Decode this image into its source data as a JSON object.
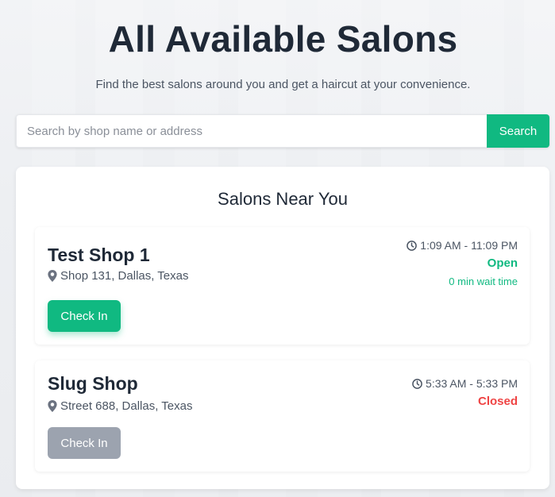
{
  "hero": {
    "title": "All Available Salons",
    "subtitle": "Find the best salons around you and get a haircut at your convenience."
  },
  "search": {
    "placeholder": "Search by shop name or address",
    "value": "",
    "button_label": "Search"
  },
  "panel": {
    "title": "Salons Near You"
  },
  "salons": [
    {
      "name": "Test Shop 1",
      "address": "Shop 131, Dallas, Texas",
      "hours": "1:09 AM - 11:09 PM",
      "status": "Open",
      "wait_time": "0 min wait time",
      "checkin_label": "Check In"
    },
    {
      "name": "Slug Shop",
      "address": "Street 688, Dallas, Texas",
      "hours": "5:33 AM - 5:33 PM",
      "status": "Closed",
      "checkin_label": "Check In"
    }
  ],
  "colors": {
    "accent": "#10b981",
    "closed": "#ef4444",
    "disabled_button": "#9ca3af"
  },
  "icons": {
    "location": "map-pin-icon",
    "time": "clock-icon"
  }
}
